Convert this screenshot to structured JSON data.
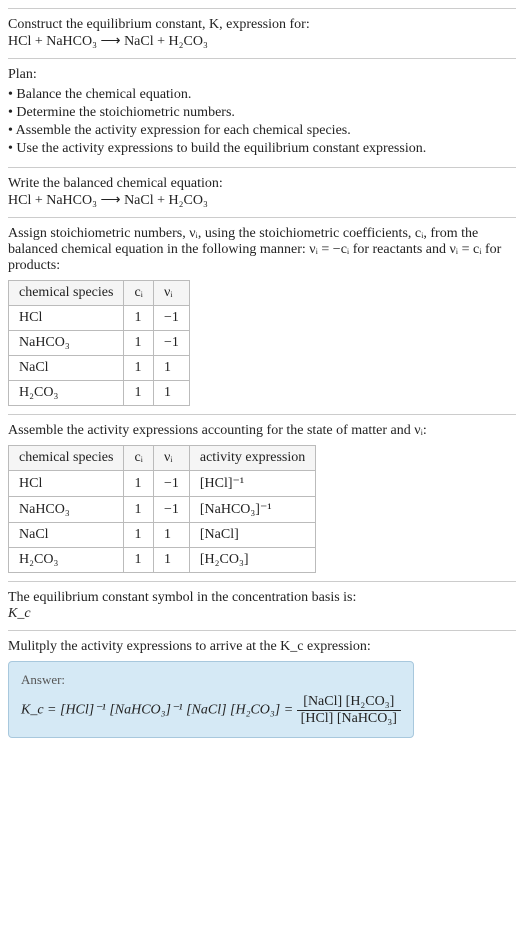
{
  "header": {
    "prompt": "Construct the equilibrium constant, K, expression for:",
    "equation": "HCl + NaHCO₃  ⟶  NaCl + H₂CO₃"
  },
  "plan": {
    "title": "Plan:",
    "items": [
      "• Balance the chemical equation.",
      "• Determine the stoichiometric numbers.",
      "• Assemble the activity expression for each chemical species.",
      "• Use the activity expressions to build the equilibrium constant expression."
    ]
  },
  "balanced": {
    "title": "Write the balanced chemical equation:",
    "equation": "HCl + NaHCO₃  ⟶  NaCl + H₂CO₃"
  },
  "stoich": {
    "intro": "Assign stoichiometric numbers, νᵢ, using the stoichiometric coefficients, cᵢ, from the balanced chemical equation in the following manner: νᵢ = −cᵢ for reactants and νᵢ = cᵢ for products:",
    "headers": [
      "chemical species",
      "cᵢ",
      "νᵢ"
    ],
    "rows": [
      [
        "HCl",
        "1",
        "−1"
      ],
      [
        "NaHCO₃",
        "1",
        "−1"
      ],
      [
        "NaCl",
        "1",
        "1"
      ],
      [
        "H₂CO₃",
        "1",
        "1"
      ]
    ]
  },
  "activity": {
    "intro": "Assemble the activity expressions accounting for the state of matter and νᵢ:",
    "headers": [
      "chemical species",
      "cᵢ",
      "νᵢ",
      "activity expression"
    ],
    "rows": [
      [
        "HCl",
        "1",
        "−1",
        "[HCl]⁻¹"
      ],
      [
        "NaHCO₃",
        "1",
        "−1",
        "[NaHCO₃]⁻¹"
      ],
      [
        "NaCl",
        "1",
        "1",
        "[NaCl]"
      ],
      [
        "H₂CO₃",
        "1",
        "1",
        "[H₂CO₃]"
      ]
    ]
  },
  "symbol": {
    "line1": "The equilibrium constant symbol in the concentration basis is:",
    "line2": "K_c"
  },
  "multiply": {
    "title": "Mulitply the activity expressions to arrive at the K_c expression:"
  },
  "answer": {
    "label": "Answer:",
    "lhs": "K_c = [HCl]⁻¹ [NaHCO₃]⁻¹ [NaCl] [H₂CO₃] =",
    "frac_num": "[NaCl] [H₂CO₃]",
    "frac_den": "[HCl] [NaHCO₃]"
  },
  "chart_data": {
    "type": "table",
    "tables": [
      {
        "title": "Stoichiometric numbers",
        "columns": [
          "chemical species",
          "c_i",
          "nu_i"
        ],
        "rows": [
          {
            "chemical species": "HCl",
            "c_i": 1,
            "nu_i": -1
          },
          {
            "chemical species": "NaHCO3",
            "c_i": 1,
            "nu_i": -1
          },
          {
            "chemical species": "NaCl",
            "c_i": 1,
            "nu_i": 1
          },
          {
            "chemical species": "H2CO3",
            "c_i": 1,
            "nu_i": 1
          }
        ]
      },
      {
        "title": "Activity expressions",
        "columns": [
          "chemical species",
          "c_i",
          "nu_i",
          "activity expression"
        ],
        "rows": [
          {
            "chemical species": "HCl",
            "c_i": 1,
            "nu_i": -1,
            "activity expression": "[HCl]^-1"
          },
          {
            "chemical species": "NaHCO3",
            "c_i": 1,
            "nu_i": -1,
            "activity expression": "[NaHCO3]^-1"
          },
          {
            "chemical species": "NaCl",
            "c_i": 1,
            "nu_i": 1,
            "activity expression": "[NaCl]"
          },
          {
            "chemical species": "H2CO3",
            "c_i": 1,
            "nu_i": 1,
            "activity expression": "[H2CO3]"
          }
        ]
      }
    ]
  }
}
